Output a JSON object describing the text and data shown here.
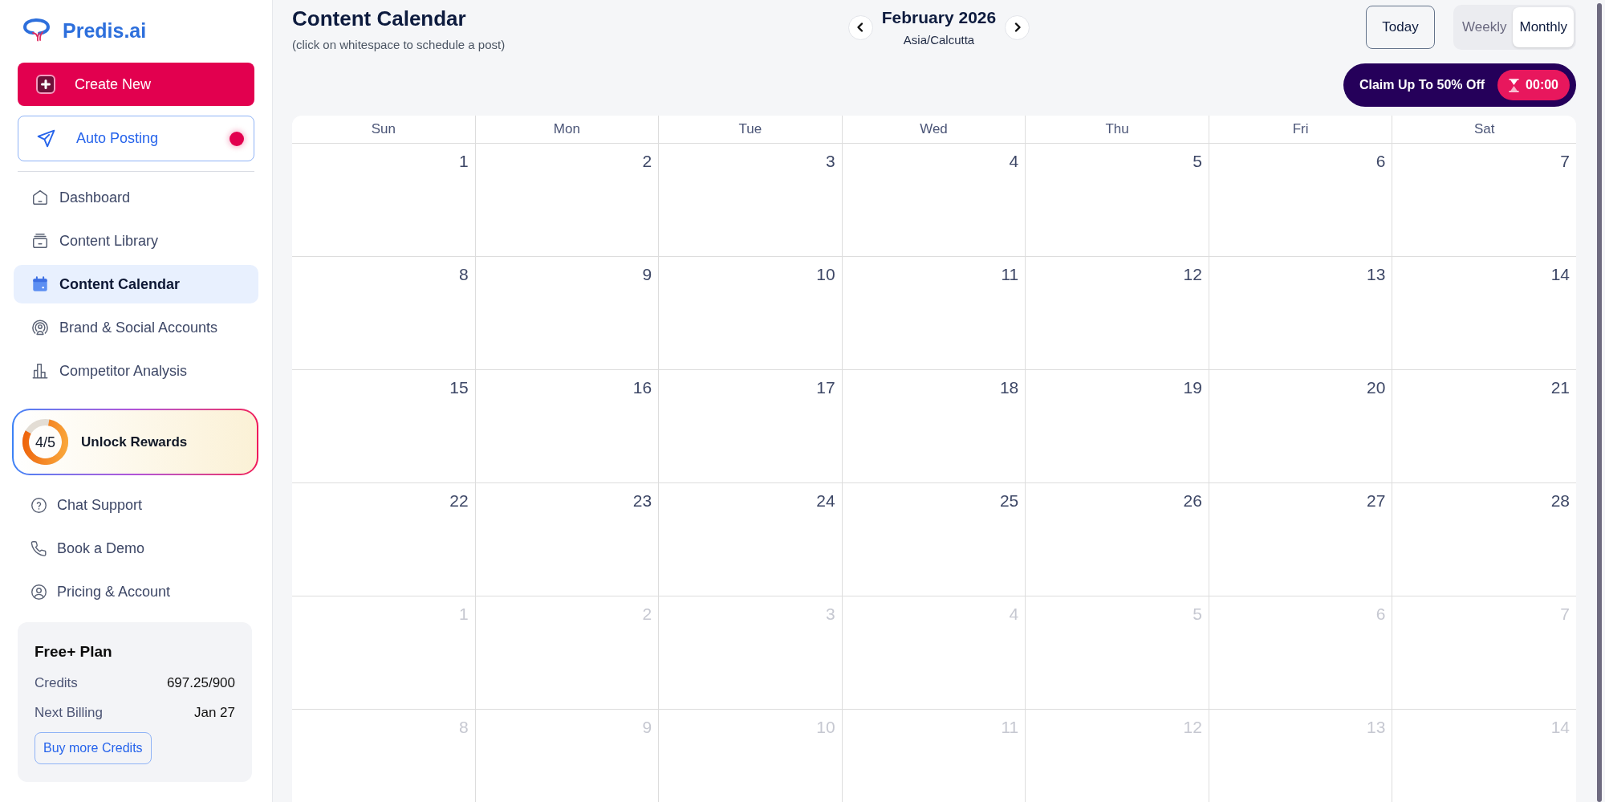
{
  "sidebar": {
    "logo": {
      "text": "Predis.ai"
    },
    "create_button": {
      "label": "Create New"
    },
    "auto_posting": {
      "label": "Auto Posting",
      "notification": true
    },
    "nav_items": [
      {
        "label": "Dashboard",
        "selected": false
      },
      {
        "label": "Content Library",
        "selected": false
      },
      {
        "label": "Content Calendar",
        "selected": true
      },
      {
        "label": "Brand & Social Accounts",
        "selected": false
      },
      {
        "label": "Competitor Analysis",
        "selected": false
      }
    ],
    "rewards": {
      "progress": "4/5",
      "level": 0.8,
      "label": "Unlock Rewards"
    },
    "support_items": [
      {
        "label": "Chat Support",
        "selected": false
      },
      {
        "label": "Book a Demo",
        "selected": false
      },
      {
        "label": "Pricing & Account",
        "selected": false
      }
    ],
    "plan": {
      "title": "Free+ Plan",
      "rows": [
        {
          "label": "Credits",
          "value": "697.25/900"
        },
        {
          "label": "Next Billing",
          "value": "Jan 27"
        }
      ],
      "button": "Buy more Credits"
    }
  },
  "header": {
    "title": "Content Calendar",
    "subtitle": "(click on whitespace to schedule a post)",
    "month": "February 2026",
    "timezone": "Asia/Calcutta",
    "today_button": "Today",
    "view_tabs": [
      {
        "label": "Weekly",
        "selected": false
      },
      {
        "label": "Monthly",
        "selected": true
      }
    ]
  },
  "promo": {
    "label": "Claim Up To 50% Off",
    "timer": "00:00"
  },
  "calendar": {
    "columns": [
      "Sun",
      "Mon",
      "Tue",
      "Wed",
      "Thu",
      "Fri",
      "Sat"
    ],
    "weeks": [
      [
        {
          "day": "1",
          "in_month": true
        },
        {
          "day": "2",
          "in_month": true
        },
        {
          "day": "3",
          "in_month": true
        },
        {
          "day": "4",
          "in_month": true
        },
        {
          "day": "5",
          "in_month": true
        },
        {
          "day": "6",
          "in_month": true
        },
        {
          "day": "7",
          "in_month": true
        }
      ],
      [
        {
          "day": "8",
          "in_month": true
        },
        {
          "day": "9",
          "in_month": true
        },
        {
          "day": "10",
          "in_month": true
        },
        {
          "day": "11",
          "in_month": true
        },
        {
          "day": "12",
          "in_month": true
        },
        {
          "day": "13",
          "in_month": true
        },
        {
          "day": "14",
          "in_month": true
        }
      ],
      [
        {
          "day": "15",
          "in_month": true
        },
        {
          "day": "16",
          "in_month": true
        },
        {
          "day": "17",
          "in_month": true
        },
        {
          "day": "18",
          "in_month": true
        },
        {
          "day": "19",
          "in_month": true
        },
        {
          "day": "20",
          "in_month": true
        },
        {
          "day": "21",
          "in_month": true
        }
      ],
      [
        {
          "day": "22",
          "in_month": true
        },
        {
          "day": "23",
          "in_month": true
        },
        {
          "day": "24",
          "in_month": true
        },
        {
          "day": "25",
          "in_month": true
        },
        {
          "day": "26",
          "in_month": true
        },
        {
          "day": "27",
          "in_month": true
        },
        {
          "day": "28",
          "in_month": true
        }
      ],
      [
        {
          "day": "1",
          "in_month": false
        },
        {
          "day": "2",
          "in_month": false
        },
        {
          "day": "3",
          "in_month": false
        },
        {
          "day": "4",
          "in_month": false
        },
        {
          "day": "5",
          "in_month": false
        },
        {
          "day": "6",
          "in_month": false
        },
        {
          "day": "7",
          "in_month": false
        }
      ],
      [
        {
          "day": "8",
          "in_month": false
        },
        {
          "day": "9",
          "in_month": false
        },
        {
          "day": "10",
          "in_month": false
        },
        {
          "day": "11",
          "in_month": false
        },
        {
          "day": "12",
          "in_month": false
        },
        {
          "day": "13",
          "in_month": false
        },
        {
          "day": "14",
          "in_month": false
        }
      ]
    ]
  }
}
